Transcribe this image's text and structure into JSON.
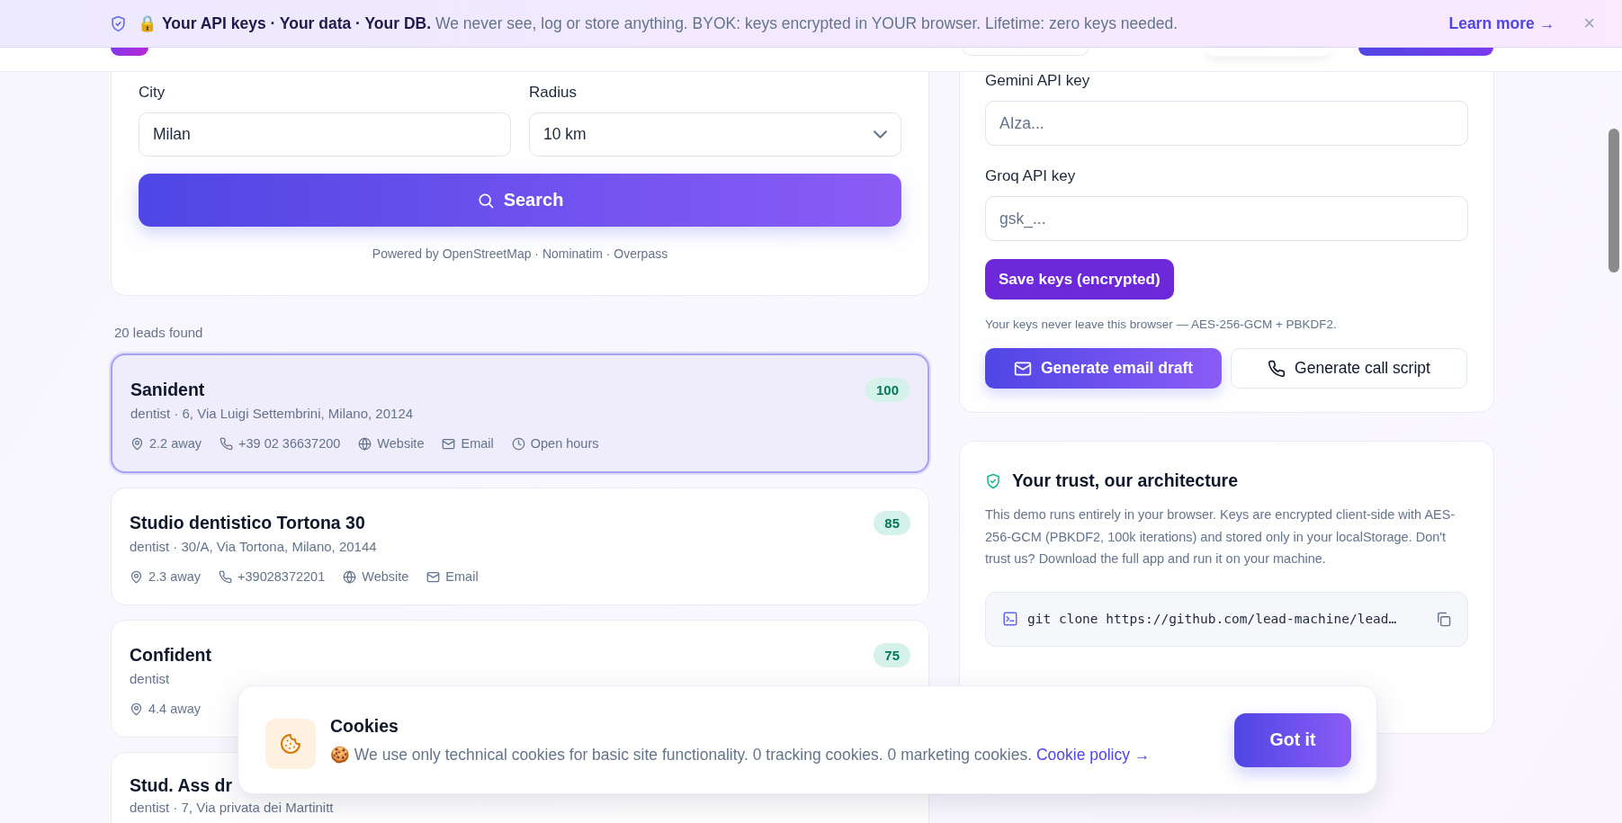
{
  "banner": {
    "text": "🔒 **Your API keys · Your data · Your DB.** We never see, log or store anything. BYOK: keys encrypted in YOUR browser. Lifetime: zero keys needed.",
    "link": "Learn more →",
    "close": "×"
  },
  "search_form": {
    "fields": [
      {
        "label": "City",
        "kind": "text",
        "value": "Milan"
      },
      {
        "label": "Radius",
        "kind": "select",
        "value": "10 km"
      }
    ],
    "button": "Search",
    "credit": "Powered by OpenStreetMap · Nominatim · Overpass"
  },
  "results": {
    "count": "20 leads found",
    "leads": [
      {
        "name": "Sanident",
        "subtitle": "dentist · 6, Via Luigi Settembrini, Milano, 20124",
        "score": "100",
        "selected": true,
        "details": [
          {
            "kind": "distance",
            "text": "2.2 away"
          },
          {
            "kind": "phone",
            "text": "+39 02 36637200"
          },
          {
            "kind": "website",
            "text": "Website"
          },
          {
            "kind": "email",
            "text": "Email"
          },
          {
            "kind": "hours",
            "text": "Open hours"
          }
        ]
      },
      {
        "name": "Studio dentistico Tortona 30",
        "subtitle": "dentist · 30/A, Via Tortona, Milano, 20144",
        "score": "85",
        "selected": false,
        "details": [
          {
            "kind": "distance",
            "text": "2.3 away"
          },
          {
            "kind": "phone",
            "text": "+39028372201"
          },
          {
            "kind": "website",
            "text": "Website"
          },
          {
            "kind": "email",
            "text": "Email"
          }
        ]
      },
      {
        "name": "Confident",
        "subtitle": "dentist",
        "score": "75",
        "selected": false,
        "details": [
          {
            "kind": "distance",
            "text": "4.4 away"
          }
        ]
      },
      {
        "name": "Stud. Ass dr",
        "subtitle": "dentist · 7, Via privata dei Martinitt",
        "selected": false
      }
    ]
  },
  "api_keys": {
    "fields": [
      {
        "label": "Gemini API key",
        "placeholder": "AIza..."
      },
      {
        "label": "Groq API key",
        "placeholder": "gsk_..."
      }
    ],
    "save_button": "Save keys (encrypted)",
    "note": "Your keys never leave this browser — AES-256-GCM + PBKDF2.",
    "actions": [
      {
        "label": "Generate email draft",
        "kind": "primary"
      },
      {
        "label": "Generate call script",
        "kind": "secondary"
      }
    ]
  },
  "trust": {
    "title": "Your trust, our architecture",
    "text": "This demo runs entirely in your browser. Keys are encrypted client-side with AES-256-GCM (PBKDF2, 100k iterations) and stored only in your localStorage. Don't trust us? Download the full app and run it on your machine.",
    "command": "git clone https://github.com/lead-machine/lead…"
  },
  "cookie_notice": {
    "title": "Cookies",
    "text": "🍪 We use only technical cookies for basic site functionality. 0 tracking cookies. 0 marketing cookies.",
    "link": "Cookie policy →",
    "button": "Got it"
  }
}
